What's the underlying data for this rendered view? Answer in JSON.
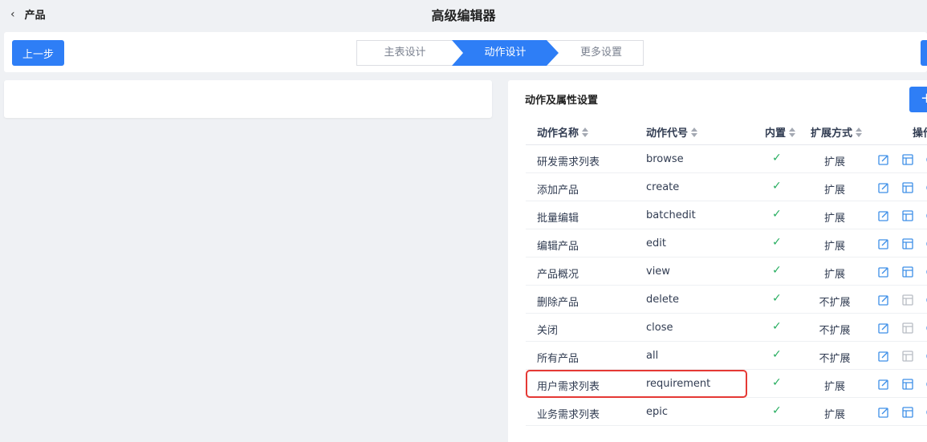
{
  "header": {
    "back_label": "产品",
    "title": "高级编辑器"
  },
  "toolbar": {
    "prev_label": "上一步",
    "steps": [
      "主表设计",
      "动作设计",
      "更多设置"
    ],
    "active_step": 1
  },
  "panel": {
    "title": "动作及属性设置",
    "add_label": "+",
    "columns": [
      "动作名称",
      "动作代号",
      "内置",
      "扩展方式",
      "操作"
    ],
    "rows": [
      {
        "name": "研发需求列表",
        "code": "browse",
        "builtin": "✓",
        "ext": "扩展"
      },
      {
        "name": "添加产品",
        "code": "create",
        "builtin": "✓",
        "ext": "扩展"
      },
      {
        "name": "批量编辑",
        "code": "batchedit",
        "builtin": "✓",
        "ext": "扩展"
      },
      {
        "name": "编辑产品",
        "code": "edit",
        "builtin": "✓",
        "ext": "扩展"
      },
      {
        "name": "产品概况",
        "code": "view",
        "builtin": "✓",
        "ext": "扩展"
      },
      {
        "name": "删除产品",
        "code": "delete",
        "builtin": "✓",
        "ext": "不扩展"
      },
      {
        "name": "关闭",
        "code": "close",
        "builtin": "✓",
        "ext": "不扩展"
      },
      {
        "name": "所有产品",
        "code": "all",
        "builtin": "✓",
        "ext": "不扩展"
      },
      {
        "name": "用户需求列表",
        "code": "requirement",
        "builtin": "✓",
        "ext": "扩展"
      },
      {
        "name": "业务需求列表",
        "code": "epic",
        "builtin": "✓",
        "ext": "扩展"
      }
    ]
  },
  "colors": {
    "primary": "#2e7ef6",
    "check": "#27ae60",
    "highlight": "#e53935",
    "icon_active": "#3d8fe8",
    "icon_disabled": "#b8bcc4"
  }
}
